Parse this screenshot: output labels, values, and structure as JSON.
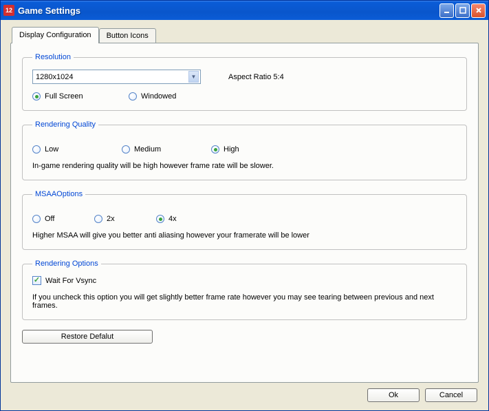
{
  "window": {
    "title": "Game Settings",
    "app_icon_text": "12"
  },
  "tabs": {
    "display_config": "Display Configuration",
    "button_icons": "Button Icons"
  },
  "resolution": {
    "legend": "Resolution",
    "selected": "1280x1024",
    "aspect_label": "Aspect Ratio 5:4",
    "full_screen": "Full Screen",
    "windowed": "Windowed",
    "mode_selected": "full_screen"
  },
  "rendering_quality": {
    "legend": "Rendering Quality",
    "low": "Low",
    "medium": "Medium",
    "high": "High",
    "selected": "high",
    "description": "In-game rendering quality will be high however frame rate will be slower."
  },
  "msaa": {
    "legend": "MSAAOptions",
    "off": "Off",
    "x2": "2x",
    "x4": "4x",
    "selected": "x4",
    "description": "Higher MSAA will give you better anti aliasing however your framerate will be lower"
  },
  "rendering_options": {
    "legend": "Rendering Options",
    "vsync_label": "Wait For Vsync",
    "vsync_checked": true,
    "description": "If you uncheck this option you will get slightly better frame rate however you may see tearing between previous and next frames."
  },
  "buttons": {
    "restore": "Restore Defalut",
    "ok": "Ok",
    "cancel": "Cancel"
  }
}
